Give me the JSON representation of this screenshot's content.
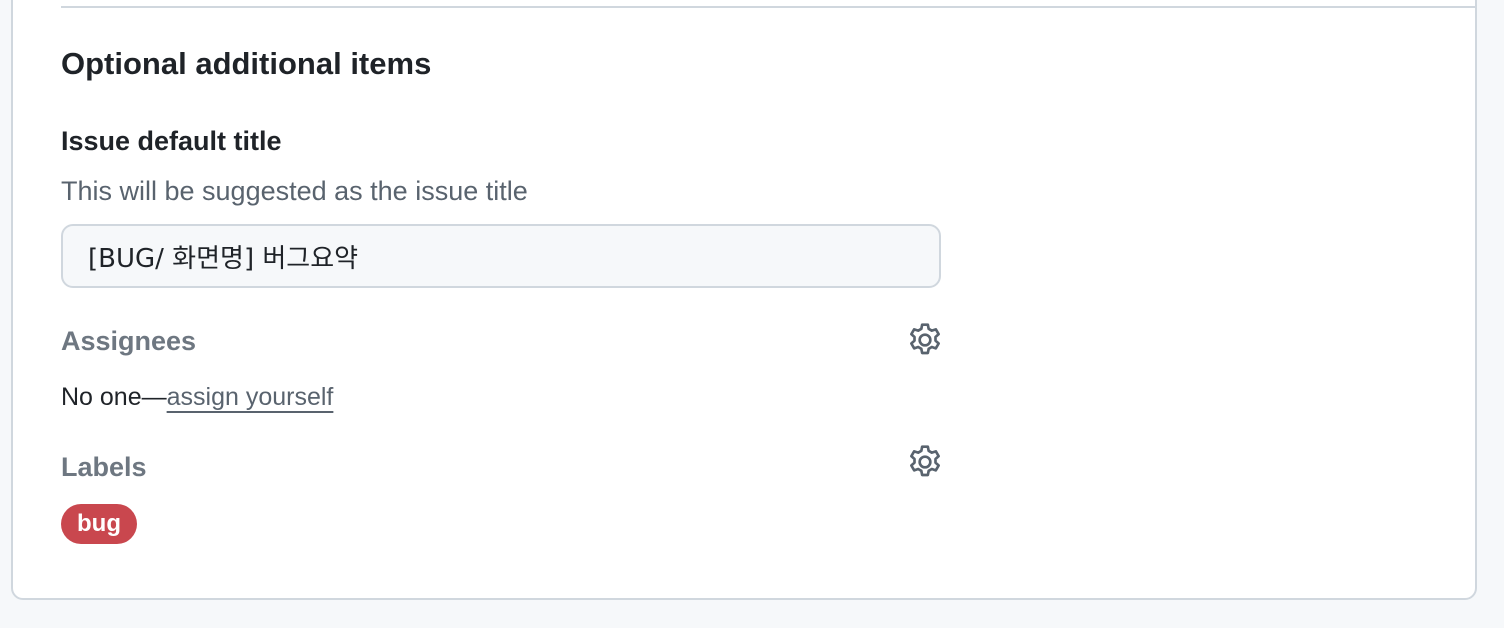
{
  "section": {
    "title": "Optional additional items"
  },
  "issue_title": {
    "label": "Issue default title",
    "help": "This will be suggested as the issue title",
    "value": "[BUG/ 화면명] 버그요약"
  },
  "assignees": {
    "label": "Assignees",
    "empty_text": "No one—",
    "assign_link": "assign yourself",
    "settings_icon": "gear-icon"
  },
  "labels": {
    "label": "Labels",
    "settings_icon": "gear-icon",
    "items": [
      {
        "name": "bug",
        "color": "#c9474e"
      }
    ]
  },
  "colors": {
    "accent_text": "#1f2328",
    "muted_text": "#59636e",
    "border": "#d0d7de",
    "background": "#f6f8fa"
  }
}
